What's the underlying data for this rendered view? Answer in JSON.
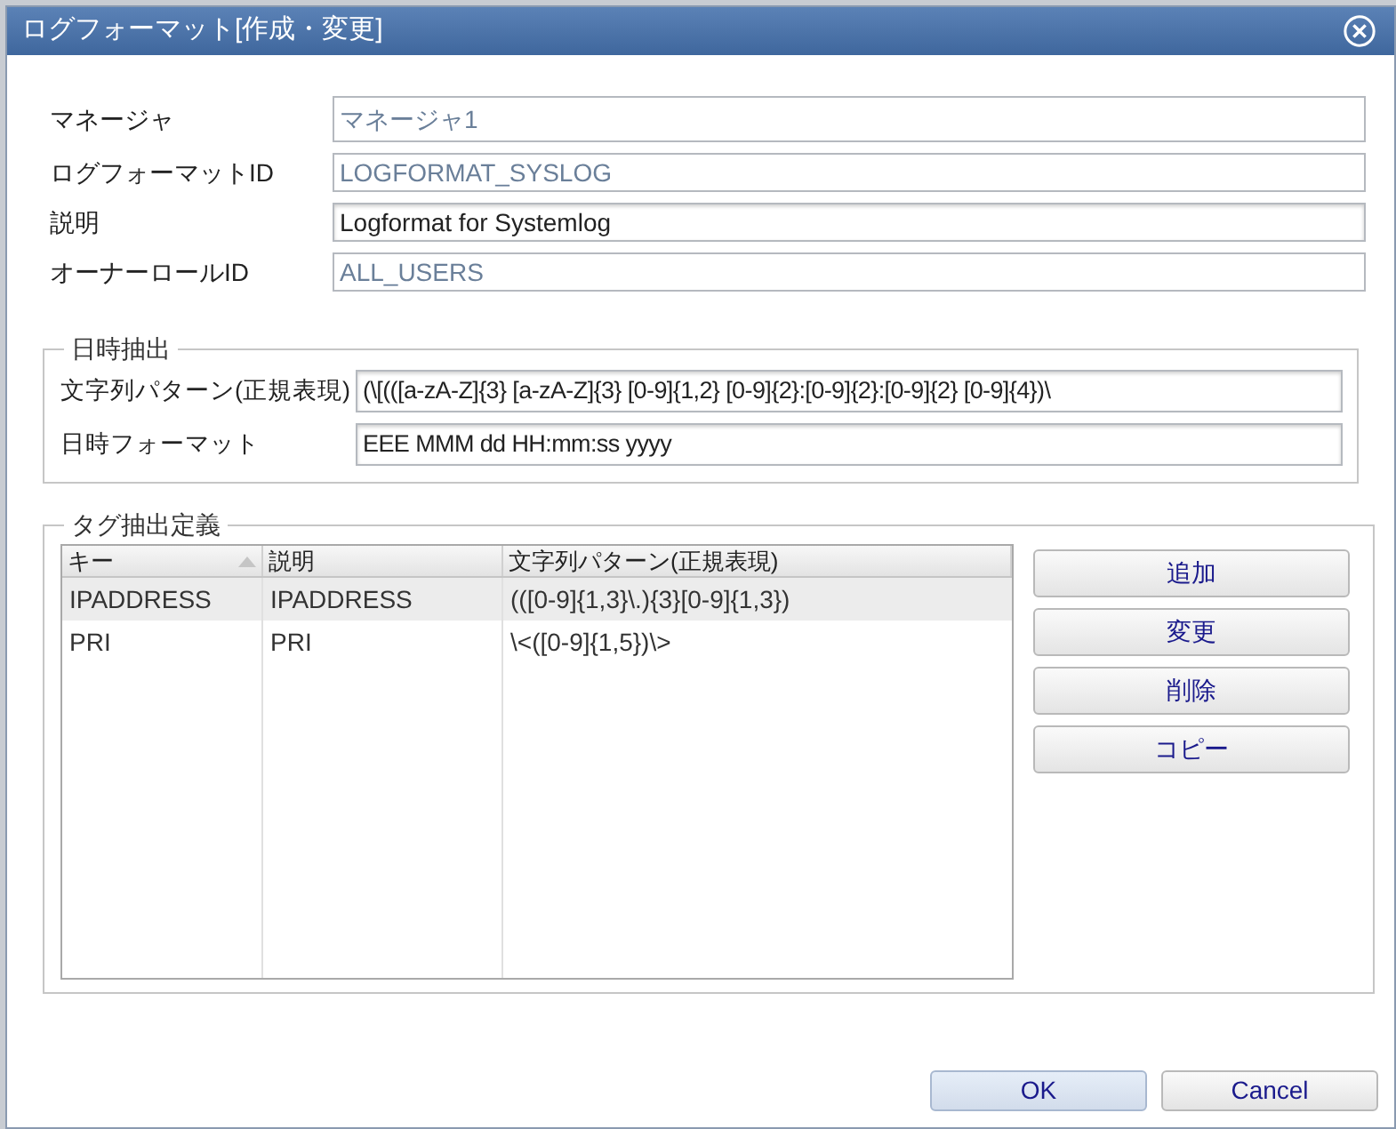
{
  "window": {
    "title": "ログフォーマット[作成・変更]"
  },
  "fields": [
    {
      "label": "マネージャ",
      "value": "マネージャ1",
      "disabled": true
    },
    {
      "label": "ログフォーマットID",
      "value": "LOGFORMAT_SYSLOG",
      "disabled": true
    },
    {
      "label": "説明",
      "value": "Logformat for Systemlog",
      "disabled": false
    },
    {
      "label": "オーナーロールID",
      "value": "ALL_USERS",
      "disabled": true
    }
  ],
  "datetime_group": {
    "title": "日時抽出",
    "fields": [
      {
        "label": "文字列パターン(正規表現)",
        "value": "(\\[(([a-zA-Z]{3} [a-zA-Z]{3} [0-9]{1,2} [0-9]{2}:[0-9]{2}:[0-9]{2} [0-9]{4})\\"
      },
      {
        "label": "日時フォーマット",
        "value": "EEE MMM dd HH:mm:ss yyyy"
      }
    ]
  },
  "tag_group": {
    "title": "タグ抽出定義",
    "table": {
      "columns": [
        {
          "label": "キー",
          "sorted": true
        },
        {
          "label": "説明",
          "sorted": false
        },
        {
          "label": "文字列パターン(正規表現)",
          "sorted": false
        }
      ],
      "rows": [
        {
          "cells": [
            "IPADDRESS",
            "IPADDRESS",
            "(([0-9]{1,3}\\.){3}[0-9]{1,3})"
          ],
          "selected": true
        },
        {
          "cells": [
            "PRI",
            "PRI",
            "\\<([0-9]{1,5})\\>"
          ],
          "selected": false
        }
      ]
    },
    "buttons": [
      "追加",
      "変更",
      "削除",
      "コピー"
    ]
  },
  "footer_buttons": [
    {
      "label": "OK",
      "default": true
    },
    {
      "label": "Cancel",
      "default": false
    }
  ]
}
